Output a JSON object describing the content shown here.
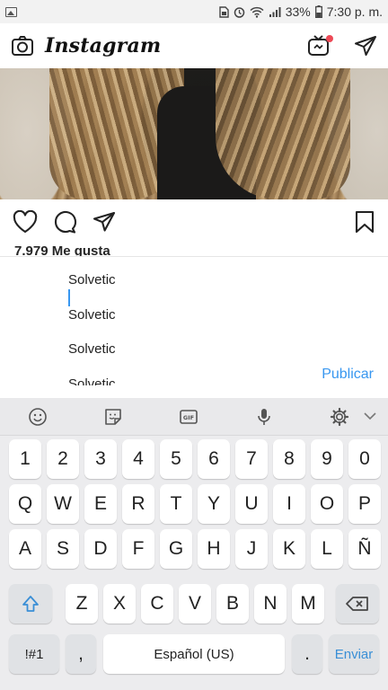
{
  "status_bar": {
    "battery": "33%",
    "time": "7:30 p. m."
  },
  "header": {
    "app_name": "Instagram"
  },
  "post": {
    "likes": "7.979 Me gusta"
  },
  "comment": {
    "lines": [
      "Solvetic",
      "Solvetic",
      "Solvetic",
      "Solvetic"
    ],
    "publish_label": "Publicar"
  },
  "keyboard": {
    "number_row": [
      "1",
      "2",
      "3",
      "4",
      "5",
      "6",
      "7",
      "8",
      "9",
      "0"
    ],
    "row1": [
      "Q",
      "W",
      "E",
      "R",
      "T",
      "Y",
      "U",
      "I",
      "O",
      "P"
    ],
    "row2": [
      "A",
      "S",
      "D",
      "F",
      "G",
      "H",
      "J",
      "K",
      "L",
      "Ñ"
    ],
    "row3": [
      "Z",
      "X",
      "C",
      "V",
      "B",
      "N",
      "M"
    ],
    "symbols_label": "!#1",
    "comma_label": ",",
    "space_label": "Español (US)",
    "period_label": ".",
    "enter_label": "Enviar"
  },
  "colors": {
    "accent": "#3897f0",
    "notification_dot": "#ed4956"
  }
}
